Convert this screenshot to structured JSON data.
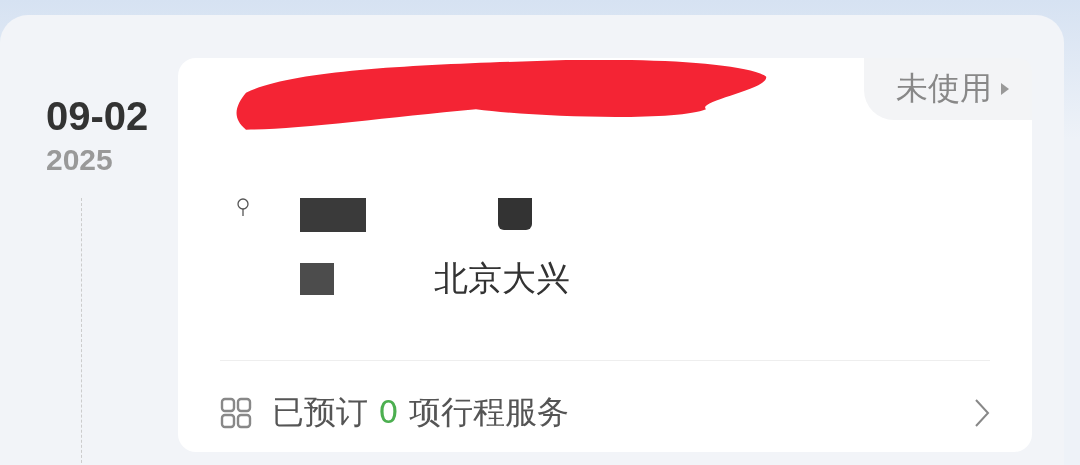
{
  "date": {
    "day": "09-02",
    "year": "2025"
  },
  "card": {
    "status": "未使用",
    "location": "北京大兴",
    "booking": {
      "prefix": "已预订",
      "count": "0",
      "suffix": "项行程服务"
    }
  }
}
